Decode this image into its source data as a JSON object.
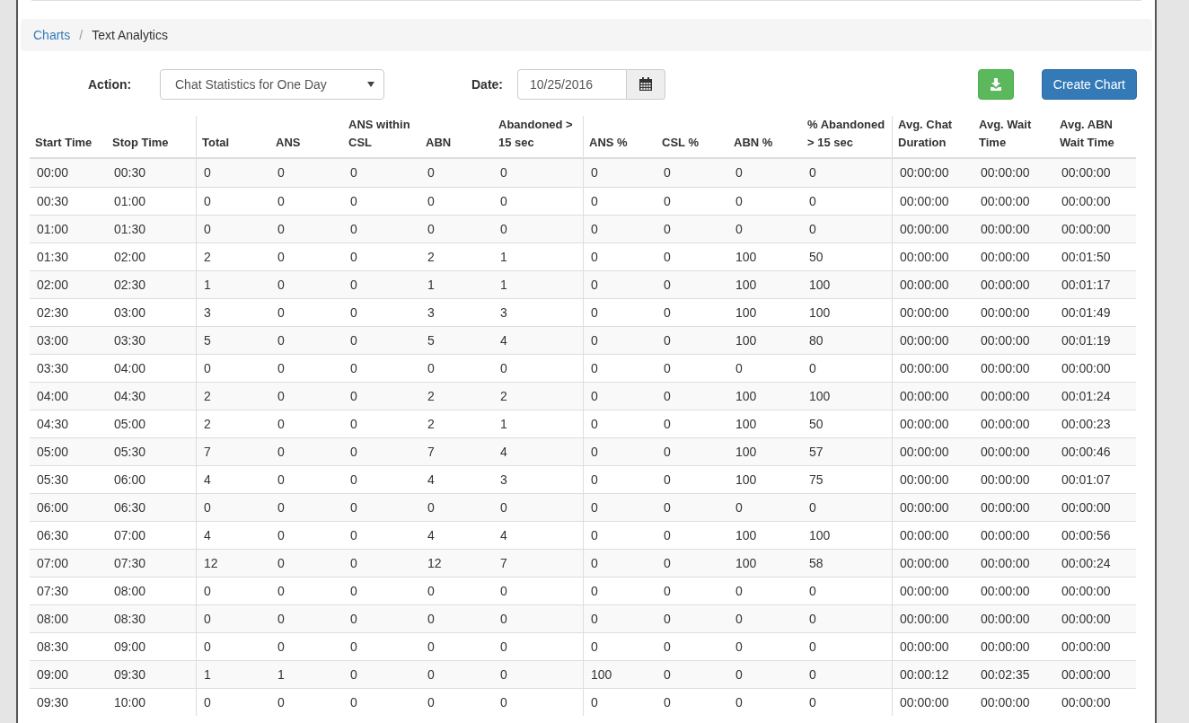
{
  "breadcrumb": [
    {
      "label": "Charts",
      "link": true
    },
    {
      "label": "Text Analytics",
      "link": false
    }
  ],
  "breadcrumb_separator": "/",
  "form": {
    "action_label": "Action:",
    "action_value": "Chat Statistics for One Day",
    "date_label": "Date:",
    "date_value": "10/25/2016",
    "create_button": "Create Chart"
  },
  "table": {
    "columns": [
      {
        "label": "Start Time",
        "group_end": false
      },
      {
        "label": "Stop Time",
        "group_end": true
      },
      {
        "label": "Total",
        "group_end": false
      },
      {
        "label": "ANS",
        "group_end": false
      },
      {
        "label": "ANS within CSL",
        "group_end": false
      },
      {
        "label": "ABN",
        "group_end": false
      },
      {
        "label": "Abandoned > 15 sec",
        "group_end": true
      },
      {
        "label": "ANS %",
        "group_end": false
      },
      {
        "label": "CSL %",
        "group_end": false
      },
      {
        "label": "ABN %",
        "group_end": false
      },
      {
        "label": "% Abandoned > 15 sec",
        "group_end": true
      },
      {
        "label": "Avg. Chat Duration",
        "group_end": false
      },
      {
        "label": "Avg. Wait Time",
        "group_end": false
      },
      {
        "label": "Avg. ABN Wait Time",
        "group_end": false
      }
    ],
    "rows": [
      [
        "00:00",
        "00:30",
        "0",
        "0",
        "0",
        "0",
        "0",
        "0",
        "0",
        "0",
        "0",
        "00:00:00",
        "00:00:00",
        "00:00:00"
      ],
      [
        "00:30",
        "01:00",
        "0",
        "0",
        "0",
        "0",
        "0",
        "0",
        "0",
        "0",
        "0",
        "00:00:00",
        "00:00:00",
        "00:00:00"
      ],
      [
        "01:00",
        "01:30",
        "0",
        "0",
        "0",
        "0",
        "0",
        "0",
        "0",
        "0",
        "0",
        "00:00:00",
        "00:00:00",
        "00:00:00"
      ],
      [
        "01:30",
        "02:00",
        "2",
        "0",
        "0",
        "2",
        "1",
        "0",
        "0",
        "100",
        "50",
        "00:00:00",
        "00:00:00",
        "00:01:50"
      ],
      [
        "02:00",
        "02:30",
        "1",
        "0",
        "0",
        "1",
        "1",
        "0",
        "0",
        "100",
        "100",
        "00:00:00",
        "00:00:00",
        "00:01:17"
      ],
      [
        "02:30",
        "03:00",
        "3",
        "0",
        "0",
        "3",
        "3",
        "0",
        "0",
        "100",
        "100",
        "00:00:00",
        "00:00:00",
        "00:01:49"
      ],
      [
        "03:00",
        "03:30",
        "5",
        "0",
        "0",
        "5",
        "4",
        "0",
        "0",
        "100",
        "80",
        "00:00:00",
        "00:00:00",
        "00:01:19"
      ],
      [
        "03:30",
        "04:00",
        "0",
        "0",
        "0",
        "0",
        "0",
        "0",
        "0",
        "0",
        "0",
        "00:00:00",
        "00:00:00",
        "00:00:00"
      ],
      [
        "04:00",
        "04:30",
        "2",
        "0",
        "0",
        "2",
        "2",
        "0",
        "0",
        "100",
        "100",
        "00:00:00",
        "00:00:00",
        "00:01:24"
      ],
      [
        "04:30",
        "05:00",
        "2",
        "0",
        "0",
        "2",
        "1",
        "0",
        "0",
        "100",
        "50",
        "00:00:00",
        "00:00:00",
        "00:00:23"
      ],
      [
        "05:00",
        "05:30",
        "7",
        "0",
        "0",
        "7",
        "4",
        "0",
        "0",
        "100",
        "57",
        "00:00:00",
        "00:00:00",
        "00:00:46"
      ],
      [
        "05:30",
        "06:00",
        "4",
        "0",
        "0",
        "4",
        "3",
        "0",
        "0",
        "100",
        "75",
        "00:00:00",
        "00:00:00",
        "00:01:07"
      ],
      [
        "06:00",
        "06:30",
        "0",
        "0",
        "0",
        "0",
        "0",
        "0",
        "0",
        "0",
        "0",
        "00:00:00",
        "00:00:00",
        "00:00:00"
      ],
      [
        "06:30",
        "07:00",
        "4",
        "0",
        "0",
        "4",
        "4",
        "0",
        "0",
        "100",
        "100",
        "00:00:00",
        "00:00:00",
        "00:00:56"
      ],
      [
        "07:00",
        "07:30",
        "12",
        "0",
        "0",
        "12",
        "7",
        "0",
        "0",
        "100",
        "58",
        "00:00:00",
        "00:00:00",
        "00:00:24"
      ],
      [
        "07:30",
        "08:00",
        "0",
        "0",
        "0",
        "0",
        "0",
        "0",
        "0",
        "0",
        "0",
        "00:00:00",
        "00:00:00",
        "00:00:00"
      ],
      [
        "08:00",
        "08:30",
        "0",
        "0",
        "0",
        "0",
        "0",
        "0",
        "0",
        "0",
        "0",
        "00:00:00",
        "00:00:00",
        "00:00:00"
      ],
      [
        "08:30",
        "09:00",
        "0",
        "0",
        "0",
        "0",
        "0",
        "0",
        "0",
        "0",
        "0",
        "00:00:00",
        "00:00:00",
        "00:00:00"
      ],
      [
        "09:00",
        "09:30",
        "1",
        "1",
        "0",
        "0",
        "0",
        "100",
        "0",
        "0",
        "0",
        "00:00:12",
        "00:02:35",
        "00:00:00"
      ],
      [
        "09:30",
        "10:00",
        "0",
        "0",
        "0",
        "0",
        "0",
        "0",
        "0",
        "0",
        "0",
        "00:00:00",
        "00:00:00",
        "00:00:00"
      ]
    ]
  }
}
